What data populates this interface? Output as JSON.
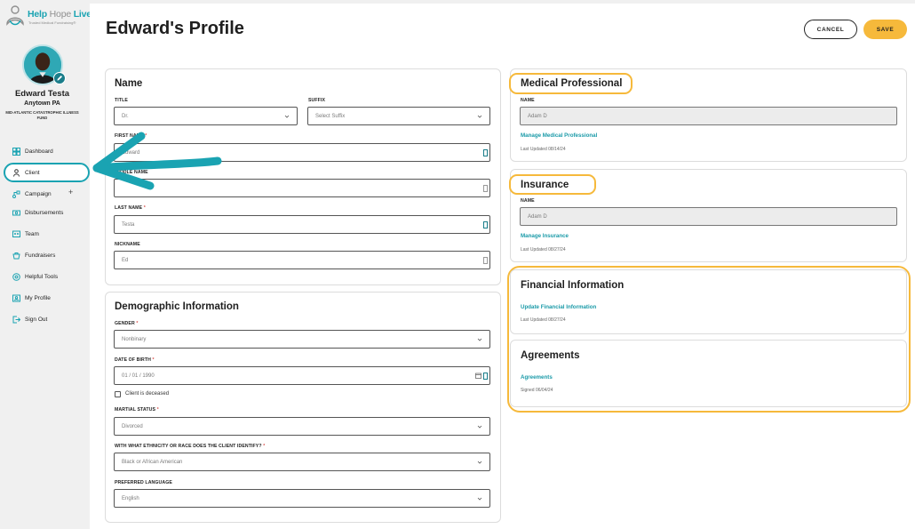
{
  "brand": {
    "name_part1": "Help ",
    "name_part2": "Hope ",
    "name_part3": "Live",
    "tagline": "Trusted Medical Fundraising®",
    "color": "#1aa3b2"
  },
  "user": {
    "name": "Edward Testa",
    "location": "Anytown PA",
    "fund": "MID-ATLANTIC CATASTROPHIC ILLNESS FUND"
  },
  "nav": {
    "dashboard": "Dashboard",
    "client": "Client",
    "campaign": "Campaign",
    "campaign_plus": "+",
    "disbursements": "Disbursements",
    "team": "Team",
    "fundraisers": "Fundraisers",
    "helpful_tools": "Helpful Tools",
    "my_profile": "My Profile",
    "sign_out": "Sign Out"
  },
  "header": {
    "title": "Edward's Profile",
    "cancel_label": "CANCEL",
    "save_label": "SAVE"
  },
  "name_card": {
    "title": "Name",
    "title_label": "TITLE",
    "title_value": "Dr.",
    "suffix_label": "SUFFIX",
    "suffix_placeholder": "Select Suffix",
    "first_name_label": "FIRST NAME",
    "first_name_value": "Edward",
    "middle_name_label": "MIDDLE NAME",
    "middle_name_value": "",
    "last_name_label": "LAST NAME",
    "last_name_value": "Testa",
    "nickname_label": "NICKNAME",
    "nickname_value": "Ed",
    "required_mark": "*"
  },
  "demographic_card": {
    "title": "Demographic Information",
    "gender_label": "GENDER",
    "gender_value": "Nonbinary",
    "dob_label": "DATE OF BIRTH",
    "dob_value": "01 / 01 / 1990",
    "deceased_label": "Client is deceased",
    "marital_label": "MARTIAL STATUS",
    "marital_value": "Divorced",
    "ethnicity_label": "WITH WHAT ETHNICITY OR RACE DOES THE CLIENT IDENTIFY?",
    "ethnicity_value": "Black or African American",
    "language_label": "PREFERRED LANGUAGE",
    "language_value": "English",
    "required_mark": "*"
  },
  "medical_card": {
    "title": "Medical Professional",
    "name_label": "NAME",
    "name_value": "Adam D",
    "link": "Manage Medical Professional",
    "updated": "Last Updated 08/14/24"
  },
  "insurance_card": {
    "title": "Insurance",
    "name_label": "NAME",
    "name_value": "Adam D",
    "link": "Manage Insurance",
    "updated": "Last Updated 08/27/24"
  },
  "financial_card": {
    "title": "Financial Information",
    "link": "Update Financial Information",
    "updated": "Last Updated 08/27/24"
  },
  "agreements_card": {
    "title": "Agreements",
    "link": "Agreements",
    "signed": "Signed 06/04/24"
  },
  "colors": {
    "accent_teal": "#1aa3b2",
    "highlight_yellow": "#f6b93b",
    "required_red": "#d9534f"
  }
}
